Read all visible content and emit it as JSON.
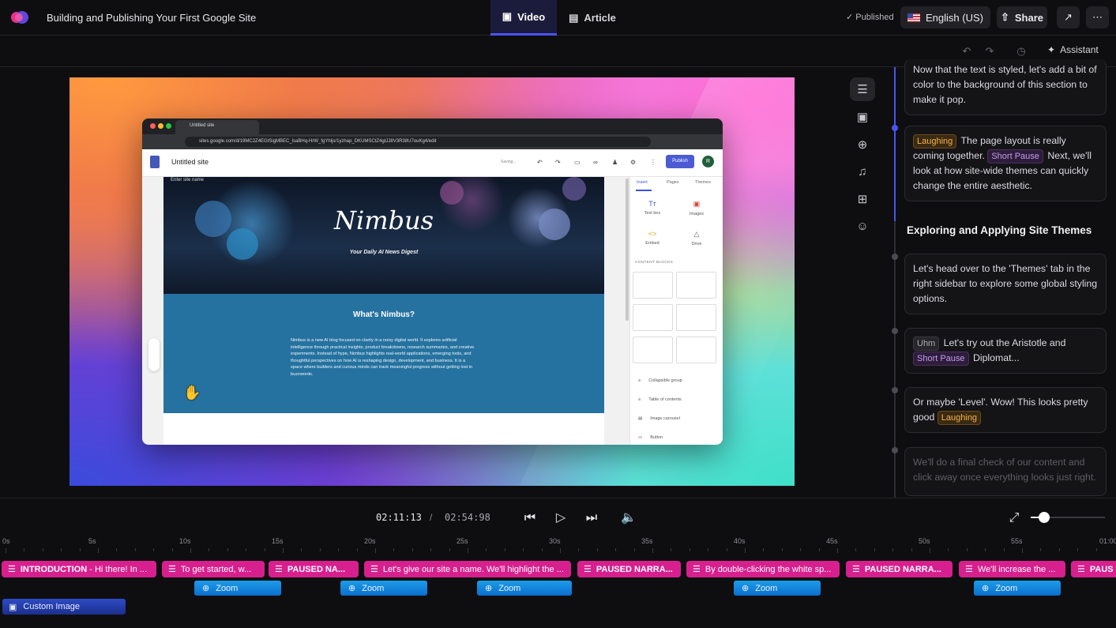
{
  "header": {
    "doc_title": "Building and Publishing Your First Google Site",
    "tabs": [
      {
        "label": "Video",
        "active": true
      },
      {
        "label": "Article",
        "active": false
      }
    ],
    "published": "Published",
    "language": "English (US)",
    "share": "Share"
  },
  "subbar": {
    "assistant": "Assistant"
  },
  "browser": {
    "tab_title": "Untitled site",
    "url": "sites.google.com/d/19MC2Z4EGtSigMBEC_lsaBHq-HrW_fgYhljs/1yzhap_DKUMSCtZ4gtJJ8V3R38U7ouKg4/edit",
    "site_title": "Untitled site",
    "saving": "Saving...",
    "publish": "Publish",
    "avatar": "R",
    "site_name_hint": "Enter site name",
    "hero_title": "Nimbus",
    "hero_subtitle": "Your Daily AI News Digest",
    "about_heading": "What's Nimbus?",
    "about_text": "Nimbus is a new AI blog focused on clarity in a noisy digital world. It explores artificial intelligence through practical insights, product breakdowns, research summaries, and creative experiments. Instead of hype, Nimbus highlights real-world applications, emerging tools, and thoughtful perspectives on how AI is reshaping design, development, and business. It is a space where builders and curious minds can track meaningful progress without getting lost in buzzwords.",
    "panel_tabs": [
      "Insert",
      "Pages",
      "Themes"
    ],
    "insert_items": [
      "Text box",
      "Images",
      "Embed",
      "Drive"
    ],
    "content_blocks_label": "CONTENT BLOCKS",
    "list_items": [
      "Collapsible group",
      "Table of contents",
      "Image carousel",
      "Button"
    ]
  },
  "transcript": {
    "card0": "Now that the text is styled, let's add a bit of color to the background of this section to make it pop.",
    "card1": {
      "tag1": "Laughing",
      "t1": "The page layout is really coming together.",
      "tag2": "Short Pause",
      "t2": "Next, we'll look at how site-wide themes can quickly change the entire aesthetic."
    },
    "section_heading": "Exploring and Applying Site Themes",
    "card2": "Let's head over to the 'Themes' tab in the right sidebar to explore some global styling options.",
    "card3": {
      "tag1": "Uhm",
      "t1": "Let's try out the Aristotle and",
      "tag2": "Short Pause",
      "t2": "Diplomat..."
    },
    "card4": {
      "t1": "Or maybe 'Level'. Wow! This looks pretty good",
      "tag1": "Laughing"
    },
    "card5": "We'll do a final check of our content and click away once everything looks just right."
  },
  "player": {
    "current": "02:11:13",
    "separator": "/",
    "total": "02:54:98",
    "zoom_level": 0.18
  },
  "ruler": [
    "0s",
    "5s",
    "10s",
    "15s",
    "20s",
    "25s",
    "30s",
    "35s",
    "40s",
    "45s",
    "50s",
    "55s",
    "01:00"
  ],
  "clips": [
    {
      "bold": "INTRODUCTION",
      "text": " - Hi there! In ..."
    },
    {
      "bold": "",
      "text": "To get started, w..."
    },
    {
      "bold": "PAUSED NA...",
      "text": ""
    },
    {
      "bold": "",
      "text": "Let's give our site a name. We'll highlight the ..."
    },
    {
      "bold": "PAUSED NARRA...",
      "text": ""
    },
    {
      "bold": "",
      "text": "By double-clicking the white sp..."
    },
    {
      "bold": "PAUSED NARRA...",
      "text": ""
    },
    {
      "bold": "",
      "text": "We'll increase the ..."
    },
    {
      "bold": "PAUS",
      "text": ""
    }
  ],
  "zoom_clips": [
    "Zoom",
    "Zoom",
    "Zoom",
    "Zoom",
    "Zoom"
  ],
  "custom_image": "Custom Image",
  "colors": {
    "accent": "#4a55f0",
    "clip": "#d81f8e",
    "zoom": "#1e9be8"
  }
}
